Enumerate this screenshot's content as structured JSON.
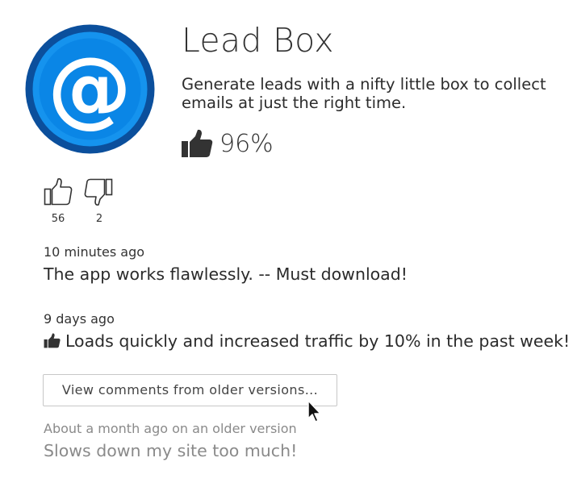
{
  "app": {
    "title": "Lead Box",
    "description": "Generate leads with a nifty little box to collect emails at just the right time.",
    "rating": "96%",
    "icon": "at-sign-icon",
    "colors": {
      "icon_blue": "#0a86e6",
      "icon_ring": "#0b4f9c"
    }
  },
  "votes": {
    "up": "56",
    "down": "2"
  },
  "comments": [
    {
      "time": "10 minutes ago",
      "text": "The app works flawlessly. -- Must download!"
    },
    {
      "time": "9 days ago",
      "text": "Loads quickly and increased traffic by 10% in the past week!",
      "thumbs_up": true
    }
  ],
  "older_button_label": "View comments from older versions...",
  "older_comments": [
    {
      "time": "About a month ago on an older version",
      "text": "Slows down my site too much!"
    }
  ]
}
